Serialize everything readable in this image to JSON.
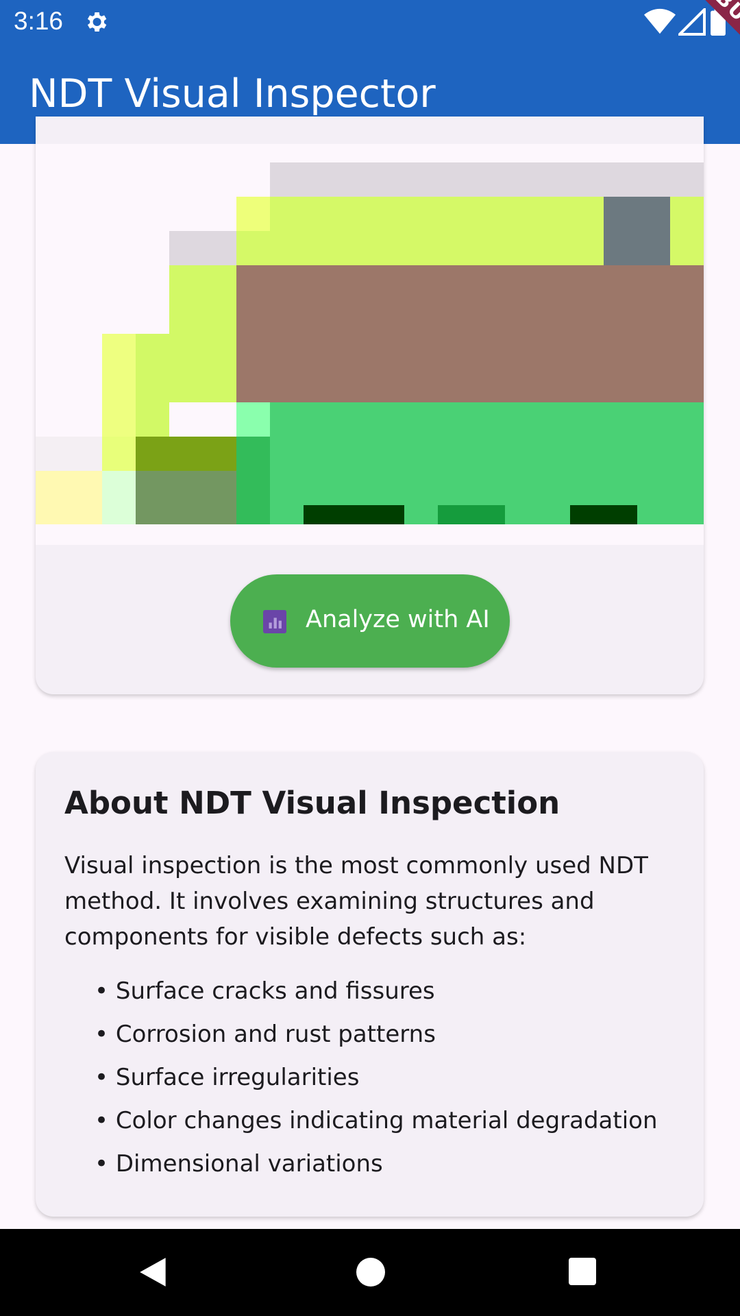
{
  "status_bar": {
    "time": "3:16",
    "icons": [
      "gear-icon",
      "wifi-icon",
      "signal-icon",
      "battery-icon"
    ]
  },
  "app_bar": {
    "title": "NDT Visual Inspector",
    "debug_banner": "DEBUG"
  },
  "image_card": {
    "button_label": "Analyze with AI",
    "button_icon": "analytics-icon",
    "button_color": "#4caf50"
  },
  "about": {
    "title": "About NDT Visual Inspection",
    "body": "Visual inspection is the most commonly used NDT method. It involves examining structures and components for visible defects such as:",
    "bullets": [
      "Surface cracks and fissures",
      "Corrosion and rust patterns",
      "Surface irregularities",
      "Color changes indicating material degradation",
      "Dimensional variations"
    ]
  },
  "nav_bar": {
    "icons": [
      "back-icon",
      "home-icon",
      "recents-icon"
    ]
  },
  "colors": {
    "primary": "#1e64c0",
    "accent_green": "#4caf50",
    "debug": "#8a2547"
  }
}
